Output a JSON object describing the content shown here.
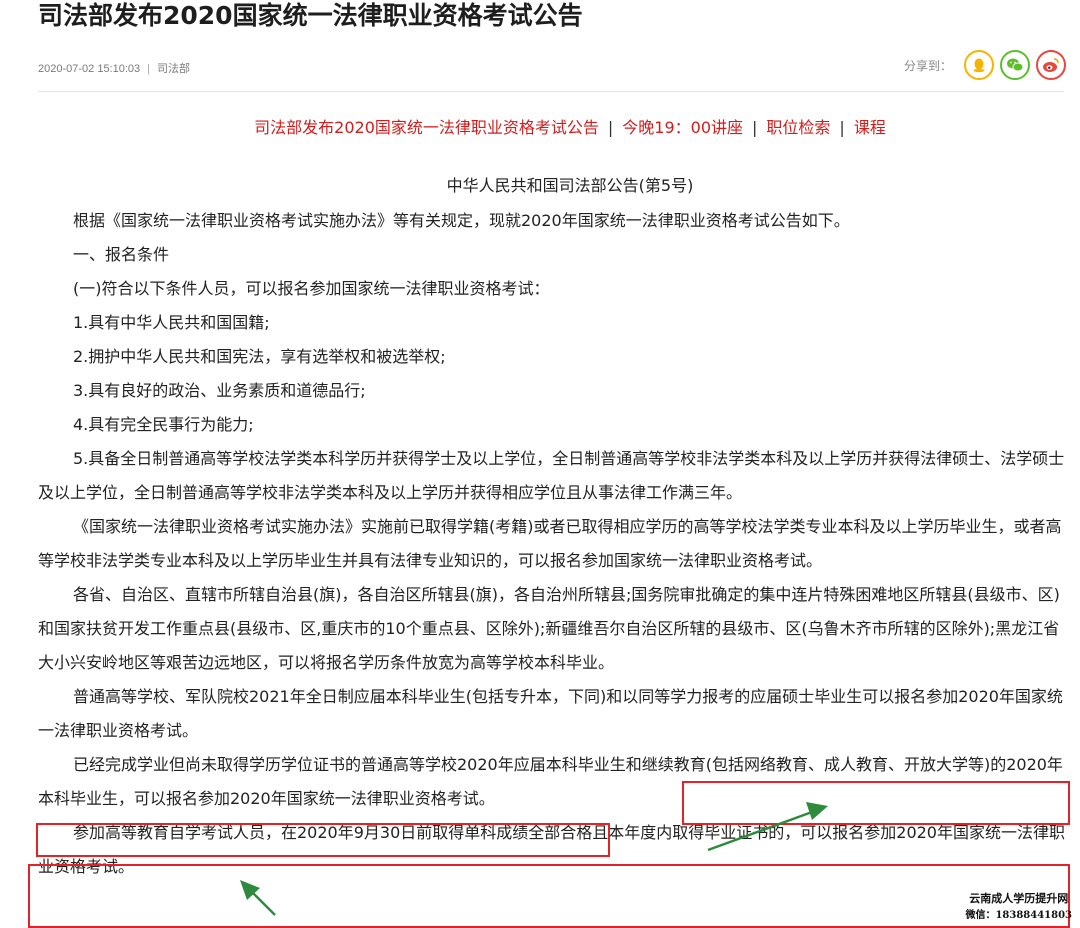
{
  "article": {
    "title": "司法部发布2020国家统一法律职业资格考试公告",
    "date": "2020-07-02 15:10:03",
    "source": "司法部",
    "share_label": "分享到："
  },
  "share": {
    "icons": [
      "qq-icon",
      "wechat-icon",
      "weibo-icon"
    ],
    "colors": {
      "qq": "#f5b400",
      "wechat": "#5cbf2a",
      "weibo": "#e8473f"
    }
  },
  "promo": {
    "link1": "司法部发布2020国家统一法律职业资格考试公告",
    "link2": "今晚19：00讲座",
    "link3": "职位检索",
    "link4": "课程",
    "separator": "|",
    "color": "#d21d1d"
  },
  "notice_heading": "中华人民共和国司法部公告(第5号)",
  "paragraphs": [
    "根据《国家统一法律职业资格考试实施办法》等有关规定，现就2020年国家统一法律职业资格考试公告如下。",
    "一、报名条件",
    "(一)符合以下条件人员，可以报名参加国家统一法律职业资格考试：",
    "1.具有中华人民共和国国籍;",
    "2.拥护中华人民共和国宪法，享有选举权和被选举权;",
    "3.具有良好的政治、业务素质和道德品行;",
    "4.具有完全民事行为能力;",
    "5.具备全日制普通高等学校法学类本科学历并获得学士及以上学位，全日制普通高等学校非法学类本科及以上学历并获得法律硕士、法学硕士及以上学位，全日制普通高等学校非法学类本科及以上学历并获得相应学位且从事法律工作满三年。",
    "《国家统一法律职业资格考试实施办法》实施前已取得学籍(考籍)或者已取得相应学历的高等学校法学类专业本科及以上学历毕业生，或者高等学校非法学类专业本科及以上学历毕业生并具有法律专业知识的，可以报名参加国家统一法律职业资格考试。",
    "各省、自治区、直辖市所辖自治县(旗)，各自治区所辖县(旗)，各自治州所辖县;国务院审批确定的集中连片特殊困难地区所辖县(县级市、区)和国家扶贫开发工作重点县(县级市、区,重庆市的10个重点县、区除外);新疆维吾尔自治区所辖的县级市、区(乌鲁木齐市所辖的区除外);黑龙江省大小兴安岭地区等艰苦边远地区，可以将报名学历条件放宽为高等学校本科毕业。",
    "普通高等学校、军队院校2021年全日制应届本科毕业生(包括专升本，下同)和以同等学力报考的应届硕士毕业生可以报名参加2020年国家统一法律职业资格考试。",
    "已经完成学业但尚未取得学历学位证书的普通高等学校2020年应届本科毕业生和继续教育(包括网络教育、成人教育、开放大学等)的2020年本科毕业生，可以报名参加2020年国家统一法律职业资格考试。",
    "参加高等教育自学考试人员，在2020年9月30日前取得单科成绩全部合格且本年度内取得毕业证书的，可以报名参加2020年国家统一法律职业资格考试。"
  ],
  "watermark": {
    "line1": "云南成人学历提升网",
    "line2": "微信：18388441803"
  },
  "annotation_colors": {
    "box": "#e3232a",
    "arrow": "#2e8b3e"
  }
}
